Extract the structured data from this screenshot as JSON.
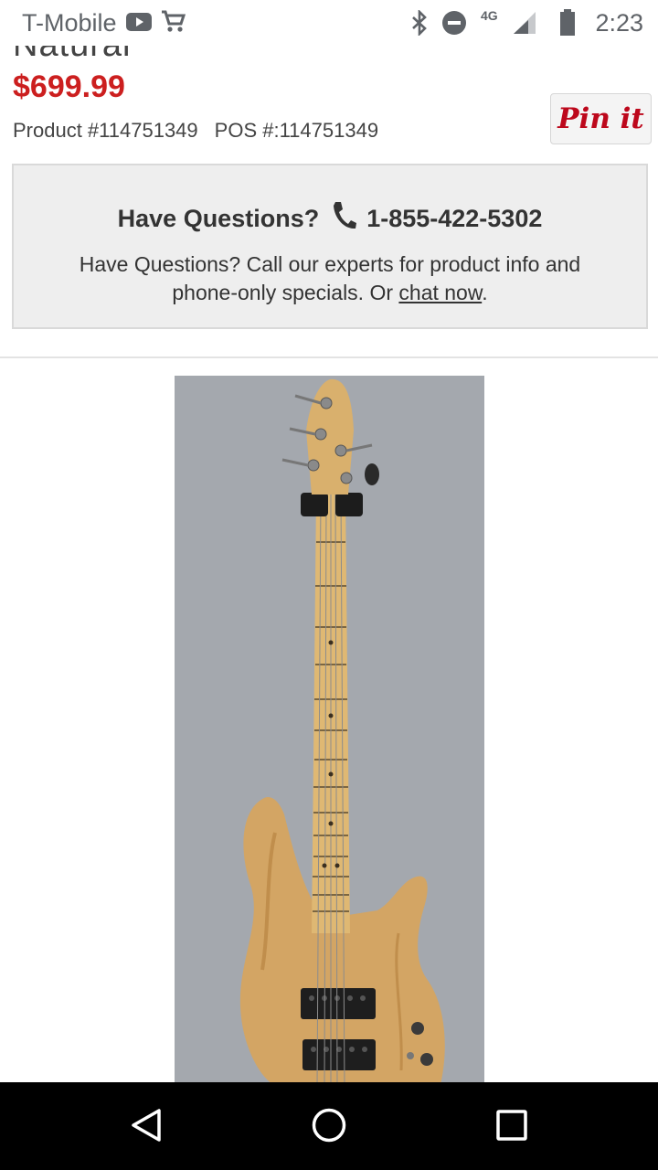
{
  "status_bar": {
    "carrier": "T-Mobile",
    "network": "4G",
    "time": "2:23",
    "icons": [
      "youtube-icon",
      "shopping-cart-icon",
      "bluetooth-icon",
      "do-not-disturb-icon",
      "signal-icon",
      "battery-icon"
    ]
  },
  "product": {
    "title_partial": "Natural",
    "price": "$699.99",
    "product_number": "Product #114751349",
    "pos_number": "POS #:114751349",
    "pin_label": "Pin it"
  },
  "questions": {
    "headline": "Have Questions?",
    "phone": "1-855-422-5302",
    "body_prefix": "Have Questions? Call our experts for product info and phone-only specials. Or ",
    "chat_link": "chat now",
    "body_suffix": "."
  },
  "image": {
    "subject": "natural-finish-5-string-bass-guitar-photo"
  },
  "nav": {
    "icons": [
      "back-icon",
      "home-icon",
      "recents-icon"
    ]
  },
  "colors": {
    "price_red": "#cc1f1f",
    "pinterest_red": "#bd081c",
    "box_bg": "#eeeeee"
  }
}
